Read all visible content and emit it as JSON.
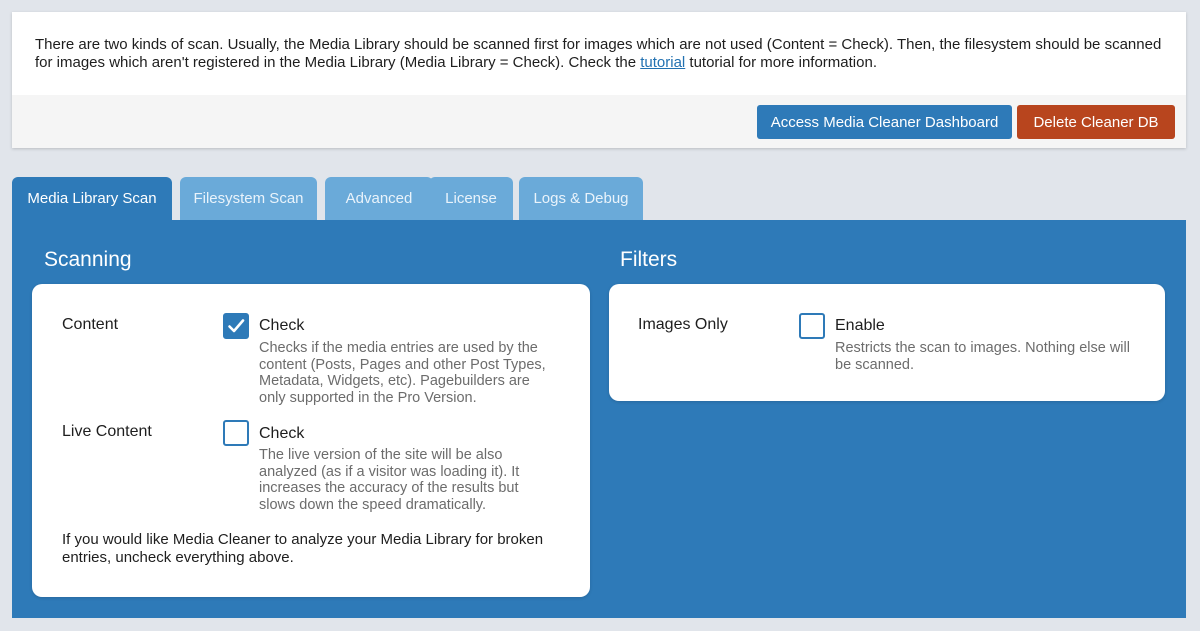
{
  "info": {
    "text_before_link": "There are two kinds of scan. Usually, the Media Library should be scanned first for images which are not used (Content = Check). Then, the filesystem should be scanned for images which aren't registered in the Media Library (Media Library = Check). Check the ",
    "link_text": "tutorial",
    "text_after_link": " tutorial for more information.",
    "buttons": {
      "dashboard": "Access Media Cleaner Dashboard",
      "delete_db": "Delete Cleaner DB"
    }
  },
  "tabs": [
    {
      "label": "Media Library Scan",
      "active": true
    },
    {
      "label": "Filesystem Scan",
      "active": false
    },
    {
      "label": "Advanced",
      "active": false
    },
    {
      "label": "License",
      "active": false
    },
    {
      "label": "Logs & Debug",
      "active": false
    }
  ],
  "scanning": {
    "title": "Scanning",
    "content": {
      "label": "Content",
      "checked": true,
      "check_label": "Check",
      "description": "Checks if the media entries are used by the content (Posts, Pages and other Post Types, Metadata, Widgets, etc). Pagebuilders are only supported in the Pro Version."
    },
    "live_content": {
      "label": "Live Content",
      "checked": false,
      "check_label": "Check",
      "description": "The live version of the site will be also analyzed (as if a visitor was loading it). It increases the accuracy of the results but slows down the speed dramatically."
    },
    "note": "If you would like Media Cleaner to analyze your Media Library for broken entries, uncheck everything above."
  },
  "filters": {
    "title": "Filters",
    "images_only": {
      "label": "Images Only",
      "checked": false,
      "check_label": "Enable",
      "description": "Restricts the scan to images. Nothing else will be scanned."
    }
  },
  "colors": {
    "primary": "#2e7ab8",
    "danger": "#b8451e",
    "tab_inactive": "#6aaad9",
    "link": "#2271b1"
  }
}
